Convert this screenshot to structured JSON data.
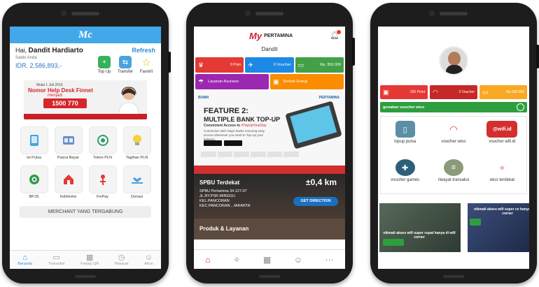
{
  "phone1": {
    "logo": "Mc",
    "greeting_prefix": "Hai,",
    "user_name": "Dandit Hardiarto",
    "refresh_label": "Refresh",
    "saldo_label": "Saldo Anda",
    "balance": "IDR. 2,586,893,-",
    "quick_actions": [
      {
        "label": "Top Up",
        "icon": "plus-circle-icon",
        "color": "#36b25a"
      },
      {
        "label": "Transfer",
        "icon": "transfer-icon",
        "color": "#4aa3df"
      },
      {
        "label": "Favorit",
        "icon": "star-icon",
        "color": "#f4b400"
      }
    ],
    "banner": {
      "top_text": "Mulai 1 Juli 2015",
      "title": "Nomor Help Desk Finnet",
      "subtitle": "menjadi",
      "phone": "1500 770"
    },
    "services": [
      {
        "label": "Isi Pulsa",
        "icon": "phone-icon"
      },
      {
        "label": "Pasca Bayar",
        "icon": "bill-icon"
      },
      {
        "label": "Token PLN",
        "icon": "token-icon"
      },
      {
        "label": "Tagihan PLN",
        "icon": "bulb-icon"
      },
      {
        "label": "BPJS",
        "icon": "bpjs-icon"
      },
      {
        "label": "IndiHome",
        "icon": "home-icon"
      },
      {
        "label": "FinPay",
        "icon": "finpay-icon"
      },
      {
        "label": "Donasi",
        "icon": "donate-icon"
      }
    ],
    "merchant_label": "MERCHANT YANG TERGABUNG",
    "nav": [
      {
        "label": "Beranda",
        "icon": "home-icon",
        "active": true
      },
      {
        "label": "Transaksi",
        "icon": "wallet-icon",
        "active": false
      },
      {
        "label": "Finpay QR",
        "icon": "qr-icon",
        "active": false
      },
      {
        "label": "Riwayat",
        "icon": "clock-icon",
        "active": false
      },
      {
        "label": "Akun",
        "icon": "user-icon",
        "active": false
      }
    ],
    "accent": "#42a8ea"
  },
  "phone2": {
    "logo_mark": "My",
    "logo_text": "PERTAMINA",
    "user_name": "Dandit",
    "tiles": [
      {
        "label": "0 Poin",
        "icon": "trophy-icon",
        "color": "#e53935"
      },
      {
        "label": "0 Voucher",
        "icon": "ticket-icon",
        "color": "#1e88e5"
      },
      {
        "label": "Rp. 350.000",
        "icon": "wallet-icon",
        "color": "#43a047"
      }
    ],
    "tiles_row2": [
      {
        "label": "Layanan Asuransi",
        "icon": "umbrella-icon",
        "color": "#9c27b0"
      },
      {
        "label": "Berkah Energi",
        "icon": "gift-icon",
        "color": "#fb8c00"
      }
    ],
    "promo": {
      "tag_left": "BUMN",
      "tag_right": "PERTAMINA",
      "title_line1": "FEATURE 2:",
      "title_line2": "MULTIPLE BANK TOP-UP",
      "tagline_prefix": "Convenient Access to",
      "tagline_hashtag": "#TopUpYourDay",
      "desc": "Connection with major banks ensuring easy access whenever you need to Top Up your balance."
    },
    "spbu": {
      "title": "SPBU Terdekat",
      "distance": "±0,4 km",
      "address_line1": "SPBU Pertamina 34.127.07",
      "address_line2": "JL.RY.PSR.MINGGU",
      "address_line3": "KEL.PANCORAN",
      "address_line4": "KEC.PANCORAN , JAKARTA",
      "button": "GET DIRECTION"
    },
    "produk_title": "Produk & Layanan",
    "nav": [
      {
        "icon": "home-icon",
        "active": true
      },
      {
        "icon": "promo-icon",
        "active": false
      },
      {
        "icon": "grid-icon",
        "active": false
      },
      {
        "icon": "user-icon",
        "active": false
      },
      {
        "icon": "more-icon",
        "active": false
      }
    ]
  },
  "phone3": {
    "tiles": [
      {
        "label": "250 Point",
        "icon": "gift-icon",
        "color": "#e53935"
      },
      {
        "label": "3 Voucher",
        "icon": "wifi-icon",
        "color": "#c62828"
      },
      {
        "label": "Rp 300.000",
        "icon": "wallet-icon",
        "color": "#f9a825"
      }
    ],
    "voucher_bar": "gunakan voucher wico",
    "services": [
      {
        "label": "topup pulsa",
        "icon": "phone-icon",
        "color": "#5b8fa8"
      },
      {
        "label": "voucher wico",
        "icon": "wifi-icon",
        "color": "#e53935"
      },
      {
        "label": "voucher wifi.id",
        "icon": "wifi-id-icon",
        "color": "#d32f2f"
      },
      {
        "label": "voucher games",
        "icon": "gamepad-icon",
        "color": "#2c5f7a"
      },
      {
        "label": "riwayat transaksi",
        "icon": "history-icon",
        "color": "#8a9a7a"
      },
      {
        "label": "wico terdekat",
        "icon": "location-icon",
        "color": "#e07a7a"
      }
    ],
    "cards": [
      {
        "caption": "nikmati akses wifi super cepat hanya di wifi corner"
      },
      {
        "caption": "nikmati akses wifi super ce hanya di wifi corner"
      }
    ]
  }
}
